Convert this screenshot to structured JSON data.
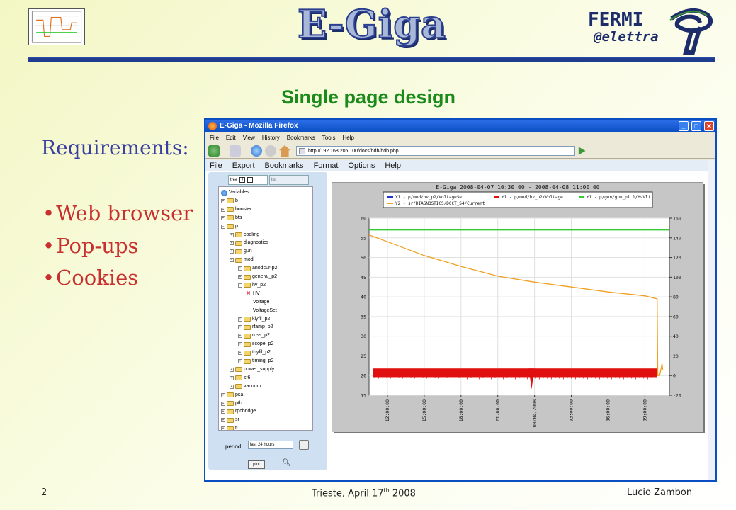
{
  "slide": {
    "brand": "E-Giga",
    "logo_text_1": "FERMI",
    "logo_text_2": "@elettra",
    "title": "Single page design",
    "requirements_heading": "Requirements:",
    "bullets": [
      "Web browser",
      "Pop-ups",
      "Cookies"
    ],
    "footer_left": "2",
    "footer_center_main": "Trieste, April 17",
    "footer_center_sup": "th",
    "footer_center_year": " 2008",
    "footer_right": "Lucio Zambon"
  },
  "browser": {
    "window_title": "E-Giga - Mozilla Firefox",
    "menu": [
      "File",
      "Edit",
      "View",
      "History",
      "Bookmarks",
      "Tools",
      "Help"
    ],
    "url": "http://192.168.205.100/docs/hdb/hdb.php"
  },
  "app": {
    "menu": [
      "File",
      "Export",
      "Bookmarks",
      "Format",
      "Options",
      "Help"
    ],
    "tabs": {
      "tree": "tree",
      "list": "list"
    },
    "tree_root": "Variables",
    "tree": [
      {
        "label": "b",
        "level": 1,
        "kind": "folder"
      },
      {
        "label": "booster",
        "level": 1,
        "kind": "folder"
      },
      {
        "label": "bts",
        "level": 1,
        "kind": "folder"
      },
      {
        "label": "p",
        "level": 1,
        "kind": "folder-open"
      },
      {
        "label": "cooling",
        "level": 2,
        "kind": "folder"
      },
      {
        "label": "diagnostics",
        "level": 2,
        "kind": "folder"
      },
      {
        "label": "gun",
        "level": 2,
        "kind": "folder"
      },
      {
        "label": "mod",
        "level": 2,
        "kind": "folder-open"
      },
      {
        "label": "anodcur-p2",
        "level": 3,
        "kind": "folder"
      },
      {
        "label": "general_p2",
        "level": 3,
        "kind": "folder"
      },
      {
        "label": "hv_p2",
        "level": 3,
        "kind": "folder-open"
      },
      {
        "label": "HV",
        "level": 4,
        "kind": "leaf-x"
      },
      {
        "label": "Voltage",
        "level": 4,
        "kind": "leaf-v"
      },
      {
        "label": "VoltageSet",
        "level": 4,
        "kind": "leaf-v"
      },
      {
        "label": "klyfil_p2",
        "level": 3,
        "kind": "folder"
      },
      {
        "label": "rfamp_p2",
        "level": 3,
        "kind": "folder"
      },
      {
        "label": "ross_p2",
        "level": 3,
        "kind": "folder"
      },
      {
        "label": "scope_p2",
        "level": 3,
        "kind": "folder"
      },
      {
        "label": "thyfil_p2",
        "level": 3,
        "kind": "folder"
      },
      {
        "label": "timing_p2",
        "level": 3,
        "kind": "folder"
      },
      {
        "label": "power_supply",
        "level": 2,
        "kind": "folder"
      },
      {
        "label": "sf6",
        "level": 2,
        "kind": "folder"
      },
      {
        "label": "vacuum",
        "level": 2,
        "kind": "folder"
      },
      {
        "label": "psa",
        "level": 1,
        "kind": "folder"
      },
      {
        "label": "ptb",
        "level": 1,
        "kind": "folder"
      },
      {
        "label": "rpcbridge",
        "level": 1,
        "kind": "folder"
      },
      {
        "label": "sr",
        "level": 1,
        "kind": "folder"
      },
      {
        "label": "tl",
        "level": 1,
        "kind": "folder"
      }
    ],
    "period_label": "period",
    "period_value": "last 24 hours",
    "plot_button": "plot"
  },
  "chart_data": {
    "type": "line",
    "title": "E-Giga 2008-04-07 10:30:00 - 2008-04-08 11:00:00",
    "legend": [
      {
        "name": "Y1 - p/mod/hv_p2/VoltageSet",
        "color": "#2233cc"
      },
      {
        "name": "Y1 - p/mod/hv_p2/Voltage",
        "color": "#e01010"
      },
      {
        "name": "Y1 - p/gun/gun_p1.1/HvVlt",
        "color": "#33cc33"
      },
      {
        "name": "Y2 - sr/DIAGNOSTICS/DCCT_S4/Current",
        "color": "#f0a020"
      }
    ],
    "x_tick_labels": [
      "12:00:00",
      "15:00:00",
      "18:00:00",
      "21:00:00",
      "08/04/2008",
      "03:00:00",
      "06:00:00",
      "09:00:00"
    ],
    "x_hours_range": [
      10.5,
      35.0
    ],
    "x_tick_hours": [
      12,
      15,
      18,
      21,
      24,
      27,
      30,
      33
    ],
    "y1lim": [
      15,
      60
    ],
    "y1_ticks": [
      15,
      20,
      25,
      30,
      35,
      40,
      45,
      50,
      55,
      60
    ],
    "y2lim": [
      -20,
      160
    ],
    "y2_ticks": [
      -20,
      0,
      20,
      40,
      60,
      80,
      100,
      120,
      140,
      160
    ],
    "grid": true,
    "series": [
      {
        "name": "Y1 - p/gun/gun_p1.1/HvVlt",
        "axis": "y1",
        "color": "#33cc33",
        "x": [
          10.5,
          35.0
        ],
        "y": [
          57,
          57
        ]
      },
      {
        "name": "Y2 - sr/DIAGNOSTICS/DCCT_S4/Current",
        "axis": "y2",
        "color": "#f0a020",
        "x": [
          10.5,
          12,
          15,
          18,
          21,
          24,
          27,
          30,
          33,
          34.0,
          34.05,
          34.2,
          34.3,
          34.4,
          34.45
        ],
        "y": [
          143,
          136,
          122,
          111,
          101,
          95,
          90,
          85,
          81,
          78,
          0,
          0,
          6,
          12,
          6
        ]
      },
      {
        "name": "Y1 - p/mod/hv_p2/Voltage",
        "axis": "y1",
        "color": "#e01010",
        "band_low": 19.6,
        "band_high": 21.8,
        "dip_x": 23.7,
        "dip_low": 16.5
      }
    ]
  }
}
